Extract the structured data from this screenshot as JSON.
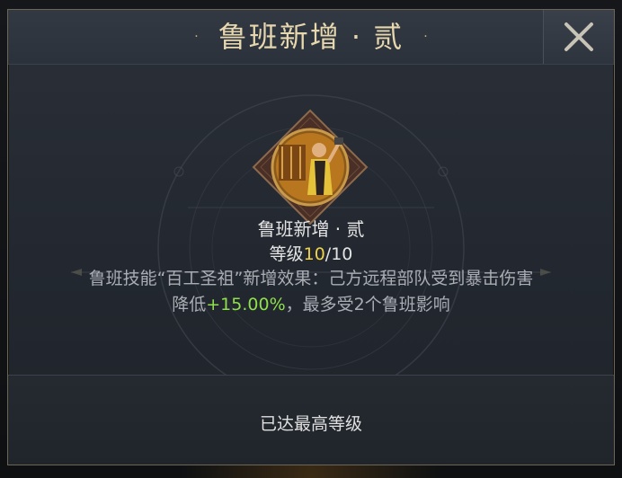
{
  "dialog": {
    "title": "鲁班新增 · 贰",
    "title_dot_left": "·",
    "title_dot_right": "·",
    "close_icon": "close-x-icon"
  },
  "skill": {
    "icon": "luban-craftsman-portrait",
    "name": "鲁班新增 · 贰",
    "level_prefix": "等级",
    "level_current": "10",
    "level_sep": "/",
    "level_max": "10"
  },
  "description": {
    "line1": "鲁班技能“百工圣祖”新增效果：己方远程部队受到暴击伤害",
    "line2_prefix": "降低",
    "line2_highlight": "+15.00%",
    "line2_suffix": "，最多受2个鲁班影响"
  },
  "footer": {
    "status": "已达最高等级"
  },
  "colors": {
    "title": "#e6d7ae",
    "level_current": "#f0d24a",
    "highlight": "#8fe04a",
    "description": "#a9adb4"
  }
}
